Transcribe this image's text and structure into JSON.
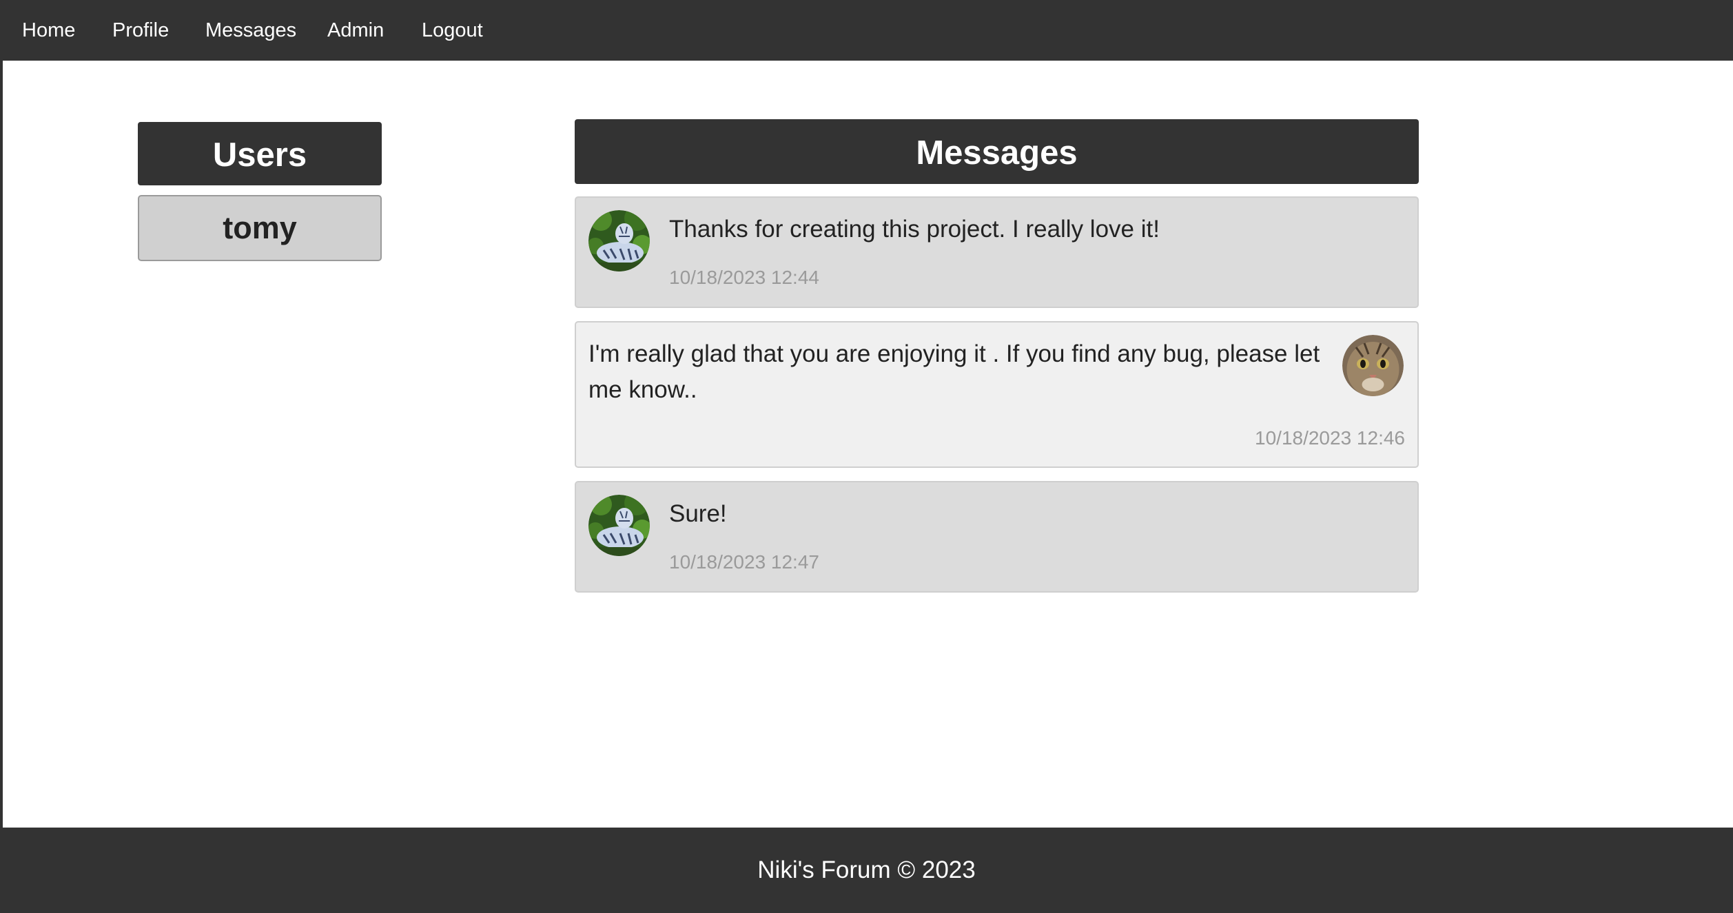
{
  "nav": {
    "items": [
      {
        "label": "Home"
      },
      {
        "label": "Profile"
      },
      {
        "label": "Messages"
      },
      {
        "label": "Admin"
      },
      {
        "label": "Logout"
      }
    ]
  },
  "users": {
    "header": "Users",
    "list": [
      {
        "name": "tomy"
      }
    ]
  },
  "messages": {
    "header": "Messages",
    "items": [
      {
        "text": "Thanks for creating this project. I really love it!",
        "time": "10/18/2023 12:44",
        "avatar": "tiger-avatar-icon"
      },
      {
        "text": "I'm really glad that you are enjoying it . If you find any bug, please let me know..",
        "time": "10/18/2023 12:46",
        "avatar": "cat-avatar-icon"
      },
      {
        "text": "Sure!",
        "time": "10/18/2023 12:47",
        "avatar": "tiger-avatar-icon"
      }
    ]
  },
  "footer": {
    "text": "Niki's Forum © 2023"
  },
  "colors": {
    "dark": "#333333",
    "received_message_bg": "#dcdcdc",
    "sent_message_bg": "#f0f0f0",
    "user_button_bg": "#d0d0d0",
    "timestamp": "#9a9a9a"
  }
}
